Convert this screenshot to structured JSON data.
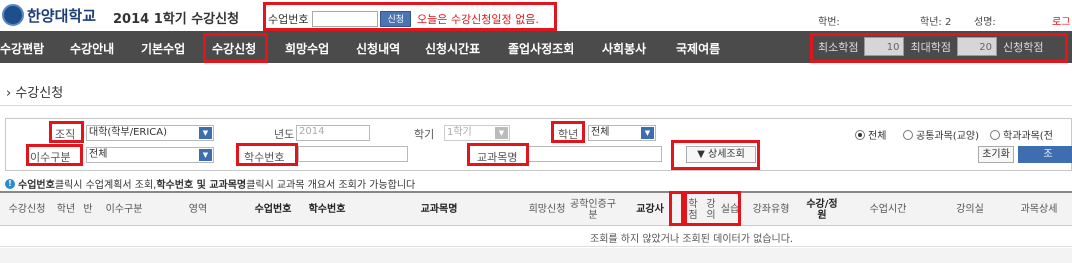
{
  "header": {
    "logo_text": "한양대학교",
    "app_title": "2014 1학기 수강신청",
    "search_label": "수업번호",
    "search_value": "",
    "search_button": "신청",
    "notice": "오늘은 수강신청일정 없음.",
    "student_id_label": "학번:",
    "grade_label": "학년: 2",
    "name_label": "성명:",
    "logout_label": "로그"
  },
  "nav": {
    "items": [
      "수강편람",
      "수강안내",
      "기본수업",
      "수강신청",
      "희망수업",
      "신청내역",
      "신청시간표",
      "졸업사정조회",
      "사회봉사",
      "국제여름"
    ],
    "min_credit_label": "최소학점",
    "min_credit_value": "10",
    "max_credit_label": "최대학점",
    "max_credit_value": "20",
    "applied_credit_label": "신청학점"
  },
  "page_title": "수강신청",
  "filters": {
    "org_label": "조직",
    "org_value": "대학(학부/ERICA)",
    "year_label": "년도",
    "year_value": "2014",
    "term_label": "학기",
    "term_value": "1학기",
    "grade_label": "학년",
    "grade_value": "전체",
    "type_label": "이수구분",
    "type_value": "전체",
    "course_no_label": "학수번호",
    "course_name_label": "교과목명",
    "detail_button": "상세조회",
    "radio_all": "전체",
    "radio_general": "공통과목(교양)",
    "radio_dept": "학과과목(전",
    "reset_button": "초기화",
    "query_button": "조"
  },
  "info": {
    "part1": "수업번호",
    "part2": " 클릭시 수업계획서 조회, ",
    "part3": "학수번호 및 교과목명",
    "part4": " 클릭시 교과목 개요서 조회가 가능합니다"
  },
  "table": {
    "columns": [
      "수강신청",
      "학년",
      "반",
      "이수구분",
      "영역",
      "수업번호",
      "학수번호",
      "교과목명",
      "희망신청",
      "공학인증구분",
      "교강사",
      "학점",
      "강의",
      "실습",
      "강좌유형",
      "수강/정원",
      "수업시간",
      "강의실",
      "과목상세"
    ],
    "empty_message": "조회를 하지 않았거나 조회된 데이터가 없습니다."
  }
}
